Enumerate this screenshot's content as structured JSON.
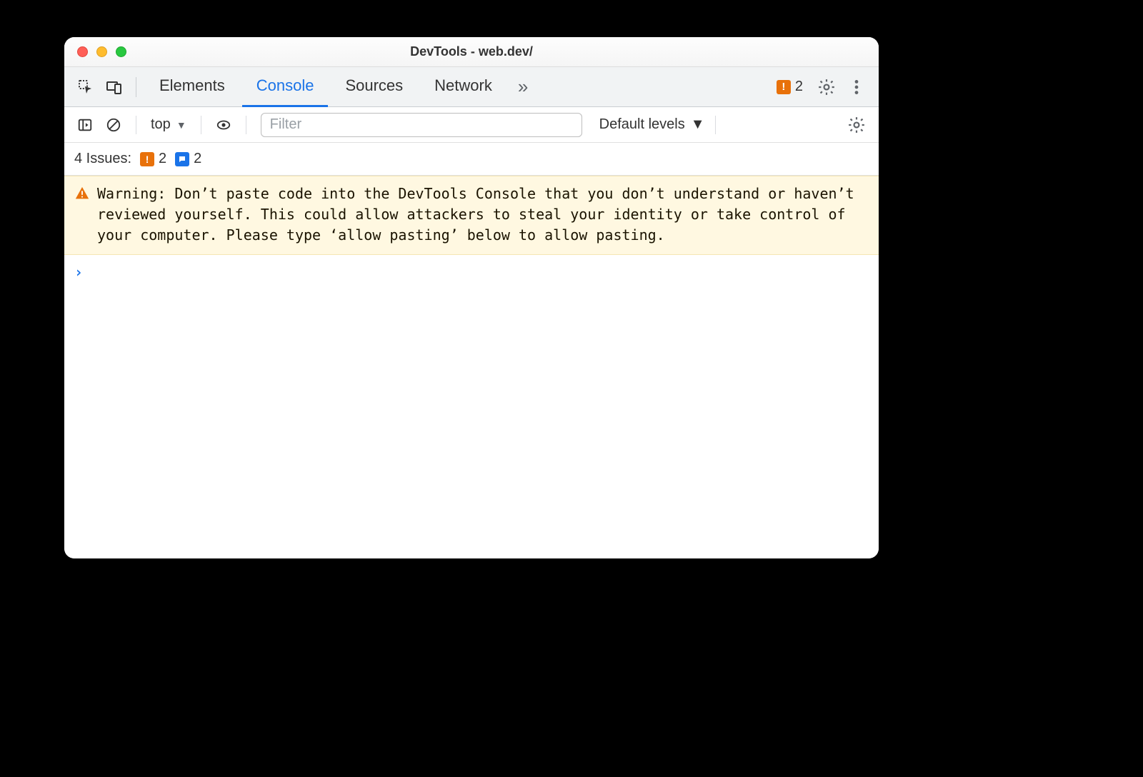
{
  "window": {
    "title": "DevTools - web.dev/"
  },
  "tabs": {
    "elements": "Elements",
    "console": "Console",
    "sources": "Sources",
    "network": "Network"
  },
  "toolbar_badge": {
    "issues_count": "2"
  },
  "console_toolbar": {
    "context": "top",
    "filter_placeholder": "Filter",
    "levels": "Default levels"
  },
  "issues_line": {
    "label": "4 Issues:",
    "orange_count": "2",
    "blue_count": "2"
  },
  "warning": {
    "text": "Warning: Don’t paste code into the DevTools Console that you don’t understand or haven’t reviewed yourself. This could allow attackers to steal your identity or take control of your computer. Please type ‘allow pasting’ below to allow pasting."
  }
}
